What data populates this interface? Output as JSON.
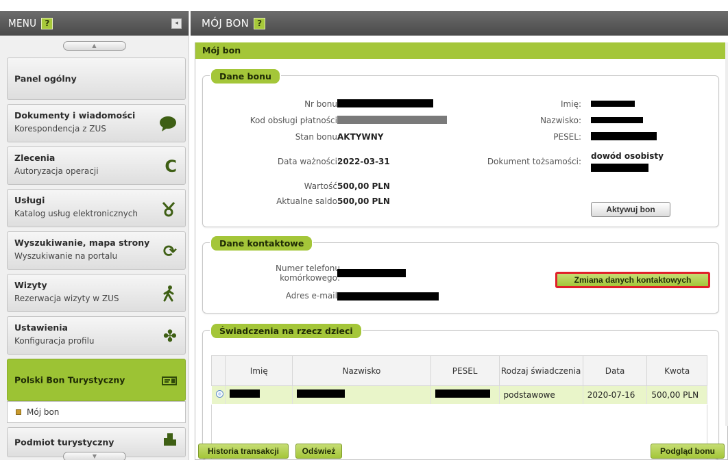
{
  "menu": {
    "title": "MENU",
    "help": "?",
    "collapse_icon": "◂",
    "scroll_up": "▲",
    "scroll_down": "▼",
    "items": [
      {
        "title": "Panel ogólny",
        "sub": "",
        "icon": ""
      },
      {
        "title": "Dokumenty i wiadomości",
        "sub": "Korespondencja z ZUS",
        "icon": "speech-bubble-icon",
        "glyph": "●"
      },
      {
        "title": "Zlecenia",
        "sub": "Autoryzacja operacji",
        "icon": "refresh-c-icon",
        "glyph": "C"
      },
      {
        "title": "Usługi",
        "sub": "Katalog usług elektronicznych",
        "icon": "services-icon",
        "glyph": "♉"
      },
      {
        "title": "Wyszukiwanie, mapa strony",
        "sub": "Wyszukiwanie na portalu",
        "icon": "sync-icon",
        "glyph": "⟳"
      },
      {
        "title": "Wizyty",
        "sub": "Rezerwacja wizyty w ZUS",
        "icon": "walking-person-icon",
        "glyph": "🚶"
      },
      {
        "title": "Ustawienia",
        "sub": "Konfiguracja profilu",
        "icon": "puzzle-icon",
        "glyph": "✤"
      },
      {
        "title": "Polski Bon Turystyczny",
        "sub": "",
        "icon": "voucher-icon",
        "glyph": "≡"
      },
      {
        "title": "Podmiot turystyczny",
        "sub": "",
        "icon": "building-icon",
        "glyph": "▙"
      }
    ],
    "submenu_item": "Mój bon"
  },
  "main": {
    "title": "MÓJ BON",
    "help": "?",
    "section_title": "Mój bon"
  },
  "dane_bonu": {
    "tab": "Dane bonu",
    "nr_bonu_label": "Nr bonu:",
    "kod_label": "Kod obsługi płatności:",
    "stan_label": "Stan bonu:",
    "stan_value": "AKTYWNY",
    "data_label": "Data ważności:",
    "data_value": "2022-03-31",
    "wartosc_label": "Wartość:",
    "wartosc_value": "500,00 PLN",
    "saldo_label": "Aktualne saldo:",
    "saldo_value": "500,00 PLN",
    "imie_label": "Imię:",
    "nazwisko_label": "Nazwisko:",
    "pesel_label": "PESEL:",
    "dokument_label": "Dokument tożsamości:",
    "dokument_value": "dowód osobisty",
    "aktywuj_button": "Aktywuj bon"
  },
  "dane_kontaktowe": {
    "tab": "Dane kontaktowe",
    "telefon_label_1": "Numer telefonu",
    "telefon_label_2": "komórkowego:",
    "email_label": "Adres e-mail:",
    "zmiana_button": "Zmiana danych kontaktowych"
  },
  "swiadczenia": {
    "tab": "Świadczenia na rzecz dzieci",
    "columns": [
      "Imię",
      "Nazwisko",
      "PESEL",
      "Rodzaj świadczenia",
      "Data",
      "Kwota"
    ],
    "rows": [
      {
        "rodzaj": "podstawowe",
        "data": "2020-07-16",
        "kwota": "500,00 PLN"
      }
    ]
  },
  "footer": {
    "historia": "Historia transakcji",
    "odswiez": "Odśwież",
    "podglad": "Podgląd bonu"
  },
  "colors": {
    "accent_green": "#a4c639",
    "header_gray": "#555555",
    "highlight_red": "#e0202a"
  }
}
